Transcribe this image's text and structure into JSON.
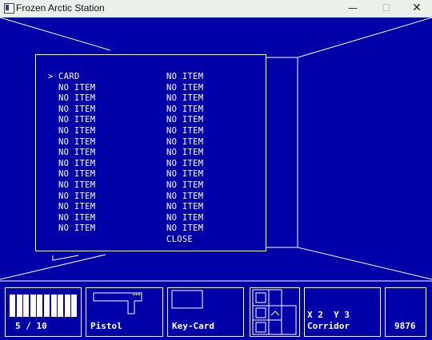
{
  "window": {
    "title": "Frozen Arctic Station",
    "min": "—",
    "max": "☐",
    "close": "✕"
  },
  "inventory": {
    "left": [
      "CARD",
      "NO ITEM",
      "NO ITEM",
      "NO ITEM",
      "NO ITEM",
      "NO ITEM",
      "NO ITEM",
      "NO ITEM",
      "NO ITEM",
      "NO ITEM",
      "NO ITEM",
      "NO ITEM",
      "NO ITEM",
      "NO ITEM",
      "NO ITEM"
    ],
    "right": [
      "NO ITEM",
      "NO ITEM",
      "NO ITEM",
      "NO ITEM",
      "NO ITEM",
      "NO ITEM",
      "NO ITEM",
      "NO ITEM",
      "NO ITEM",
      "NO ITEM",
      "NO ITEM",
      "NO ITEM",
      "NO ITEM",
      "NO ITEM",
      "NO ITEM",
      "CLOSE"
    ],
    "cursor": ">",
    "selected_index": 0
  },
  "hud": {
    "ammo": {
      "text": "5 / 10",
      "current": 5,
      "max": 10
    },
    "weapon": {
      "label": "Pistol",
      "icon": "pistol-icon"
    },
    "item": {
      "label": "Key-Card",
      "icon": "card-icon"
    },
    "map": {
      "icon": "minimap-icon"
    },
    "location": {
      "coords": "X 2  Y 3",
      "name": "Corridor"
    },
    "score": "9876"
  },
  "colors": {
    "background": "#0000a8",
    "lines": "#ffffff",
    "titlebar": "#e9f2ea"
  }
}
